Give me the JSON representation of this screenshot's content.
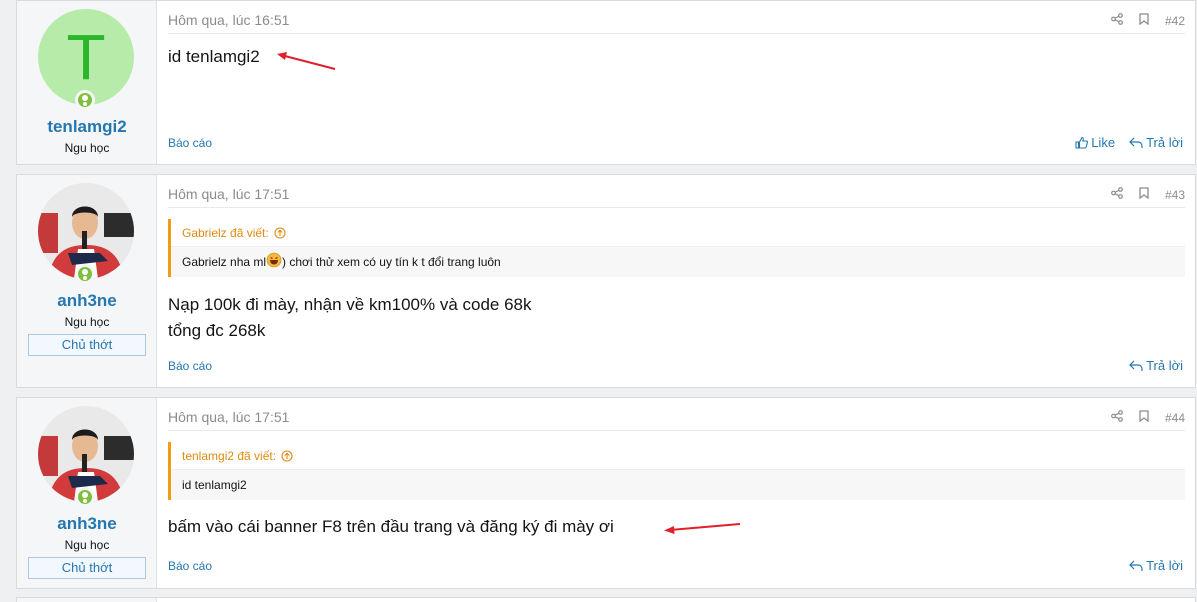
{
  "posts": [
    {
      "avatar_letter": "T",
      "username": "tenlamgi2",
      "usertitle": "Ngu học",
      "time": "Hôm qua, lúc 16:51",
      "number": "#42",
      "message_lines": [
        "id tenlamgi2"
      ],
      "report": "Báo cáo",
      "like": "Like",
      "reply": "Trả lời"
    },
    {
      "username": "anh3ne",
      "usertitle": "Ngu học",
      "banner": "Chủ thớt",
      "time": "Hôm qua, lúc 17:51",
      "number": "#43",
      "quote_author": "Gabrielz đã viết:",
      "quote_text_a": "Gabrielz nha ml",
      "quote_text_b": ") chơi thử xem có uy tín k t đổi trang luôn",
      "message_lines": [
        "Nạp 100k đi mày, nhận về km100% và code 68k",
        "tổng đc 268k"
      ],
      "report": "Báo cáo",
      "reply": "Trả lời"
    },
    {
      "username": "anh3ne",
      "usertitle": "Ngu học",
      "banner": "Chủ thớt",
      "time": "Hôm qua, lúc 17:51",
      "number": "#44",
      "quote_author": "tenlamgi2 đã viết:",
      "quote_text": "id tenlamgi2",
      "message_lines": [
        "bấm vào cái banner F8 trên đầu trang và đăng ký đi mày ơi"
      ],
      "report": "Báo cáo",
      "reply": "Trả lời"
    }
  ],
  "colors": {
    "link": "#2577b1",
    "quote_accent": "#f39c12",
    "online": "#7fbf3f",
    "arrow": "#e0202a"
  },
  "icons": [
    "share-icon",
    "bookmark-icon",
    "like-icon",
    "reply-icon",
    "arrow-up-circle-icon",
    "laugh-emoji-icon",
    "online-status-icon"
  ]
}
